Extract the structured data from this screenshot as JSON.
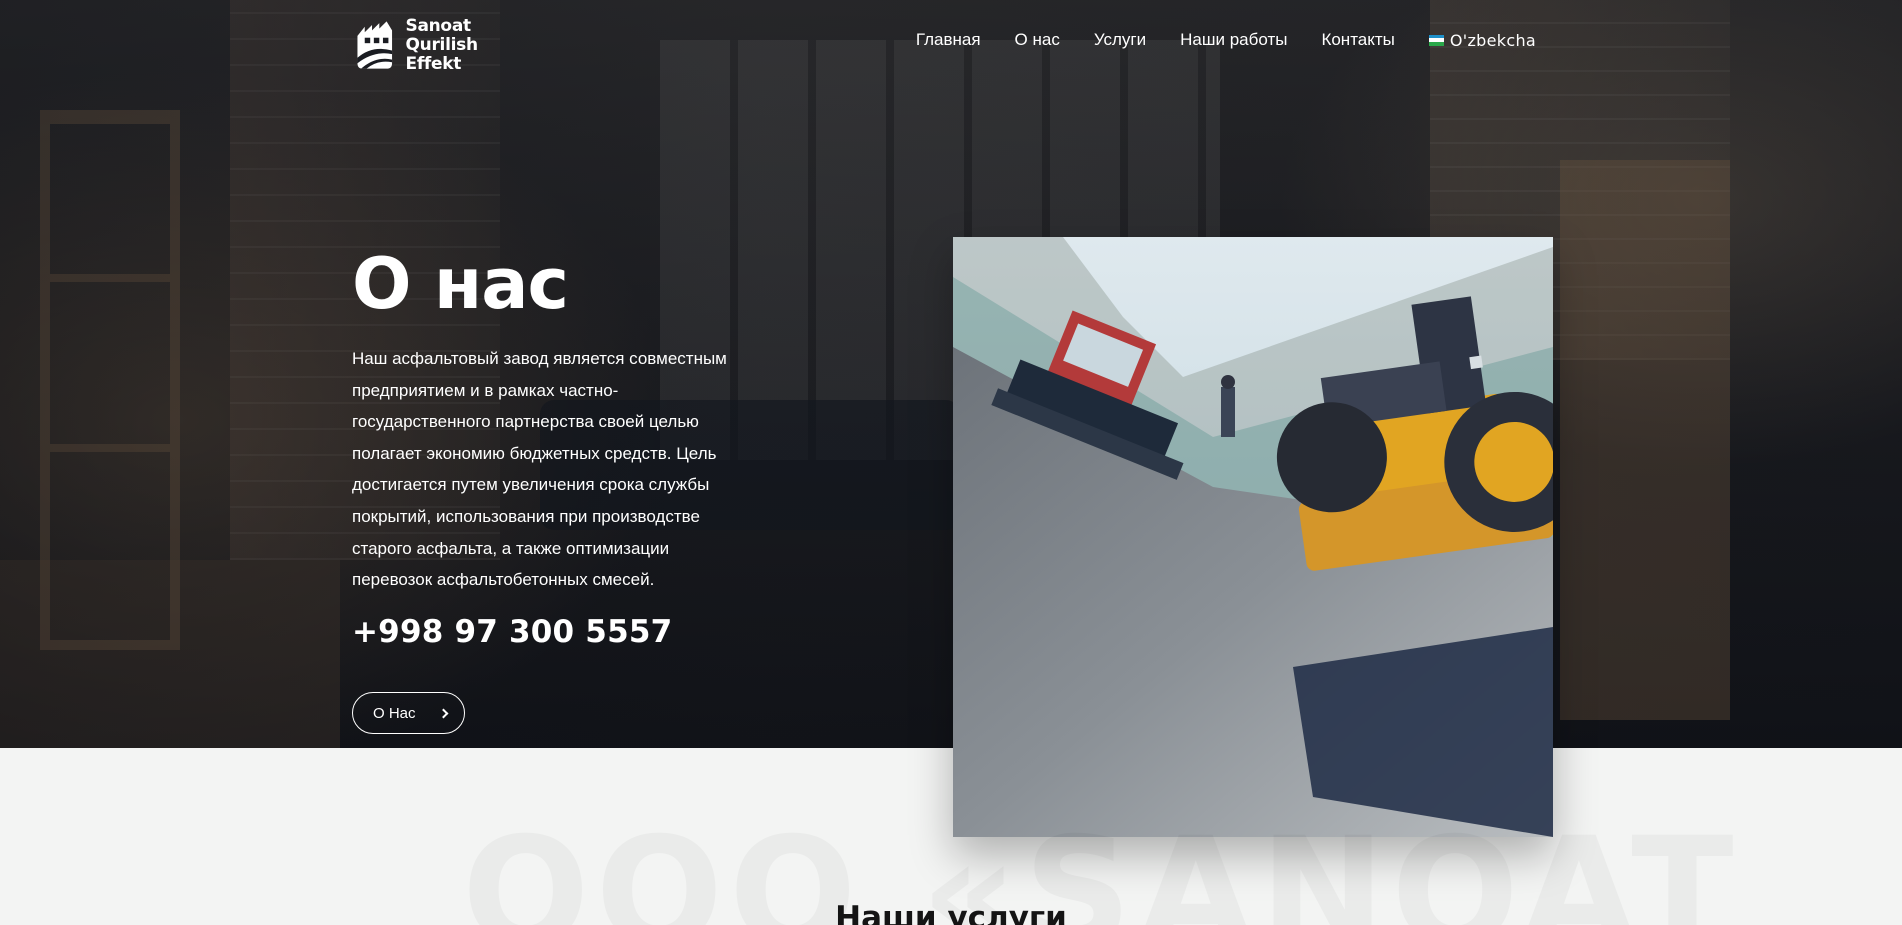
{
  "brand": {
    "name_line1": "Sanoat",
    "name_line2": "Qurilish Effekt"
  },
  "nav": {
    "items": [
      "Главная",
      "О нас",
      "Услуги",
      "Наши работы",
      "Контакты"
    ],
    "language": "O'zbekcha",
    "language_flag_colors": [
      "#1e90c9",
      "#ffffff",
      "#2aa84a"
    ]
  },
  "hero": {
    "title": "О нас",
    "description": "Наш асфальтовый завод является совместным предприятием и в рамках частно-государственного партнерства своей целью полагает экономию бюджетных средств. Цель достигается путем увеличения срока службы покрытий, использования при производстве старого асфальта, а также оптимизации перевозок асфальтобетонных смесей.",
    "phone": "+998 97 300 5557",
    "button_label": "О Нас",
    "button_icon": "chevron-right-icon"
  },
  "services": {
    "watermark": "ООО «SANOAT",
    "title": "Наши услуги"
  }
}
